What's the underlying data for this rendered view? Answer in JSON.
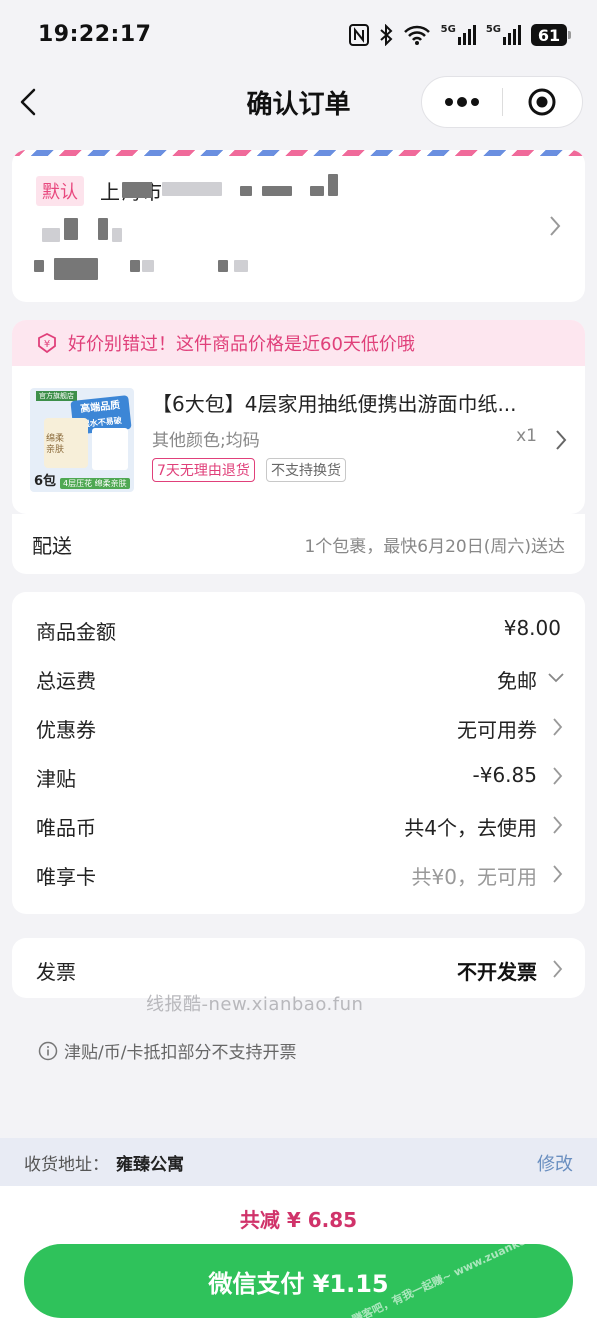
{
  "status_bar": {
    "time": "19:22:17",
    "battery": "61",
    "signal_label_1": "5G",
    "signal_label_2": "5G"
  },
  "nav": {
    "title": "确认订单"
  },
  "address": {
    "default_tag": "默认",
    "line1_visible": "上海市 "
  },
  "promo": {
    "text": "好价别错过！这件商品价格是近60天低价哦"
  },
  "product": {
    "title": "【6大包】4层家用抽纸便携出游面巾纸...",
    "spec": "其他颜色;均码",
    "quantity": "x1",
    "badge_return": "7天无理由退货",
    "badge_no_exchange": "不支持换货",
    "image_texts": {
      "brand": "官方旗舰店",
      "slogan1": "高端品质",
      "slogan2": "湿水不易破",
      "pack": "6包",
      "tag": "4层压花 绵柔亲肤",
      "box": "绵柔亲肤"
    }
  },
  "shipping": {
    "label": "配送",
    "info": "1个包裹，最快6月20日(周六)送达"
  },
  "fees": [
    {
      "label": "商品金额",
      "value": "¥8.00"
    },
    {
      "label": "总运费",
      "value": "免邮"
    },
    {
      "label": "优惠券",
      "value": "无可用券"
    },
    {
      "label": "津贴",
      "value": "-¥6.85"
    },
    {
      "label": "唯品币",
      "value": "共4个，去使用"
    },
    {
      "label": "唯享卡",
      "value": "共¥0，无可用"
    }
  ],
  "invoice": {
    "label": "发票",
    "value": "不开发票"
  },
  "watermark": "线报酷-new.xianbao.fun",
  "note": "津贴/币/卡抵扣部分不支持开票",
  "bottom": {
    "address_label": "收货地址：",
    "address_value": "雍臻公寓",
    "edit": "修改",
    "saved": "共减 ¥ 6.85",
    "pay_button": "微信支付 ¥1.15",
    "button_watermark": "赚客吧，有我一起赚~ www.zuanke8.com"
  },
  "colors": {
    "accent_pink": "#e0407a",
    "pay_green": "#2fc25b",
    "background": "#f3f3f6"
  }
}
